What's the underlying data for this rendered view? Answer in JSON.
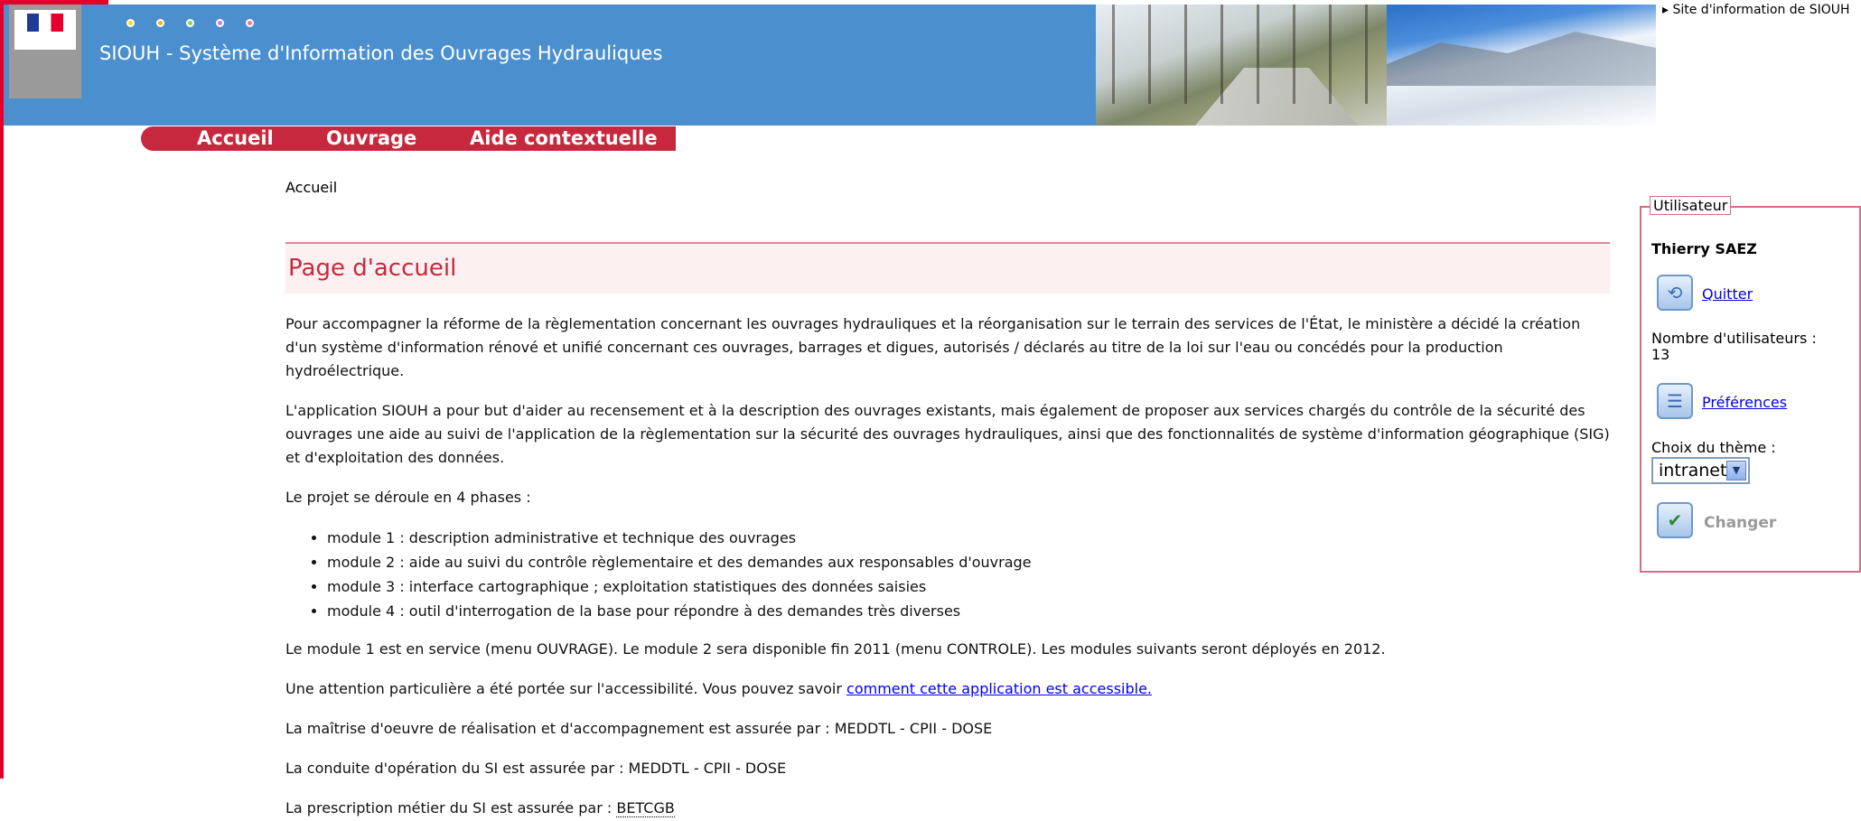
{
  "header": {
    "app_title": "SIOUH - Système d'Information des Ouvrages Hydrauliques",
    "site_note": "▸ Site d'information de SIOUH",
    "dot_colors": [
      "#ffd900",
      "#ffb100",
      "#7ed957",
      "#c77dff",
      "#ff6fa0"
    ]
  },
  "nav": {
    "items": [
      {
        "label": "Accueil"
      },
      {
        "label": "Ouvrage"
      },
      {
        "label": "Aide contextuelle"
      }
    ]
  },
  "breadcrumb": "Accueil",
  "page_title": "Page d'accueil",
  "content": {
    "p1": "Pour accompagner la réforme de la règlementation concernant les ouvrages hydrauliques et la réorganisation sur le terrain des services de l'État, le ministère a décidé la création d'un système d'information rénové et unifié concernant ces ouvrages, barrages et digues, autorisés / déclarés au titre de la loi sur l'eau ou concédés pour la production hydroélectrique.",
    "p2": "L'application SIOUH a pour but d'aider au recensement et à la description des ouvrages existants, mais également de proposer aux services chargés du contrôle de la sécurité des ouvrages une aide au suivi de l'application de la règlementation sur la sécurité des ouvrages hydrauliques, ainsi que des fonctionnalités de système d'information géographique (SIG) et d'exploitation des données.",
    "p3": "Le projet se déroule en 4 phases :",
    "modules": [
      "module 1 : description administrative et technique des ouvrages",
      "module 2 : aide au suivi du contrôle règlementaire et des demandes aux responsables d'ouvrage",
      "module 3 : interface cartographique ; exploitation statistiques des données saisies",
      "module 4 : outil d'interrogation de la base pour répondre à des demandes très diverses"
    ],
    "p4": "Le module 1 est en service (menu OUVRAGE). Le module 2 sera disponible fin 2011 (menu CONTROLE). Les modules suivants seront déployés en 2012.",
    "p5_prefix": "Une attention particulière a été portée sur l'accessibilité. Vous pouvez savoir ",
    "p5_link": "comment cette application est accessible.",
    "p6": "La maîtrise d'oeuvre de réalisation et d'accompagnement est assurée par : MEDDTL - CPII - DOSE",
    "p7": "La conduite d'opération du SI est assurée par : MEDDTL - CPII - DOSE",
    "p8_prefix": "La prescription métier du SI est assurée par : ",
    "p8_abbr": "BETCGB"
  },
  "user_panel": {
    "legend": "Utilisateur",
    "name": "Thierry SAEZ",
    "quit_label": "Quitter",
    "users_count_label": "Nombre d'utilisateurs :",
    "users_count": "13",
    "preferences_label": "Préférences",
    "theme_label": "Choix du thème :",
    "theme_value": "intranet",
    "change_label": "Changer"
  }
}
